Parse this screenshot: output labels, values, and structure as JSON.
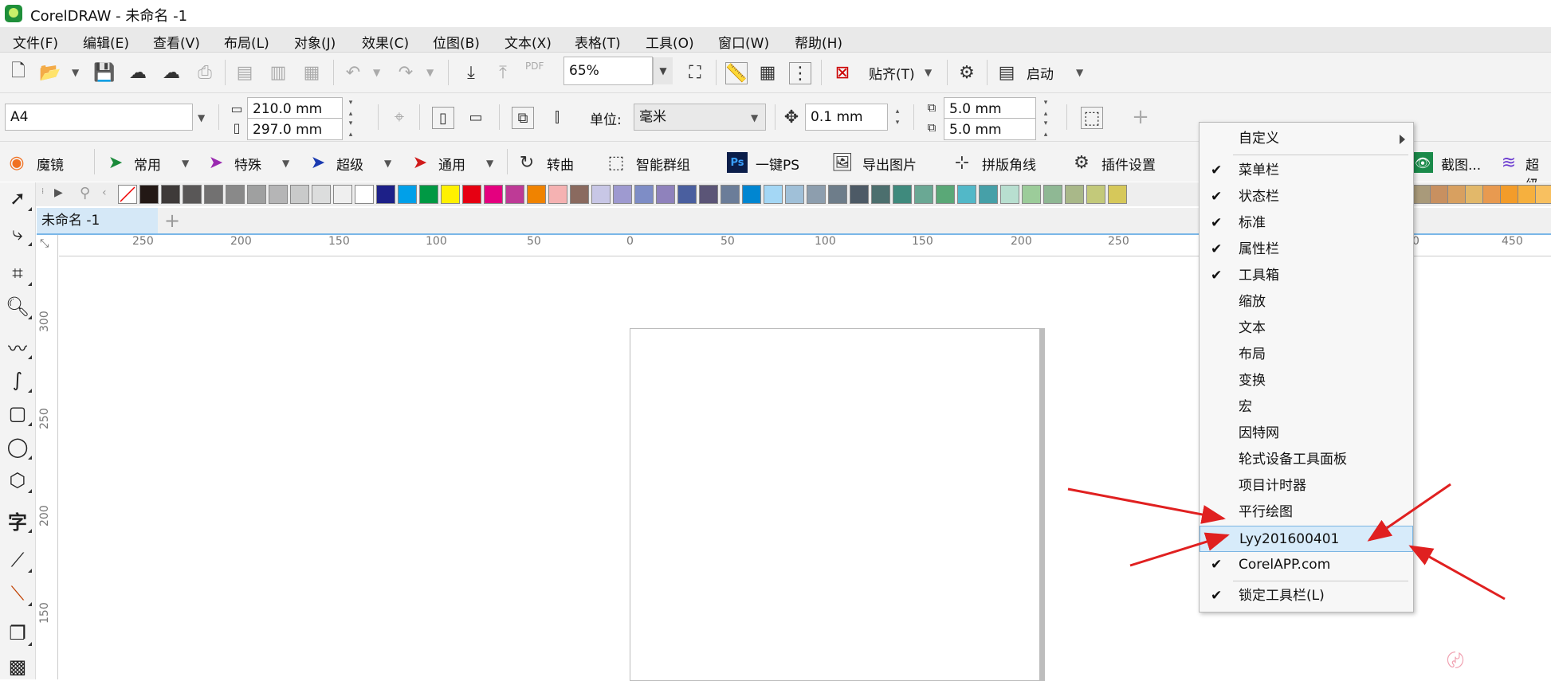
{
  "window": {
    "title": "CorelDRAW - 未命名 -1"
  },
  "menubar": {
    "items": [
      "文件(F)",
      "编辑(E)",
      "查看(V)",
      "布局(L)",
      "对象(J)",
      "效果(C)",
      "位图(B)",
      "文本(X)",
      "表格(T)",
      "工具(O)",
      "窗口(W)",
      "帮助(H)"
    ]
  },
  "toolbar1": {
    "zoom_value": "65%",
    "snap_label": "贴齐(T)",
    "launch_label": "启动",
    "pdf_label": "PDF"
  },
  "toolbar2": {
    "page_size": "A4",
    "width": "210.0 mm",
    "height": "297.0 mm",
    "units_label": "单位:",
    "units_value": "毫米",
    "nudge": "0.1 mm",
    "dup_x": "5.0 mm",
    "dup_y": "5.0 mm"
  },
  "toolbar3": {
    "items": [
      "魔镜",
      "常用",
      "特殊",
      "超级",
      "通用",
      "转曲",
      "智能群组",
      "一键PS",
      "导出图片",
      "拼版角线",
      "插件设置"
    ],
    "right_items": [
      "截图...",
      "超级"
    ],
    "ps_badge": "Ps"
  },
  "palette": {
    "colors": [
      "#231815",
      "#3e3a39",
      "#595757",
      "#727171",
      "#898989",
      "#9fa0a0",
      "#b5b5b6",
      "#c9caca",
      "#dcdddd",
      "#efefef",
      "#ffffff",
      "#1d2088",
      "#00a0e9",
      "#009944",
      "#fff100",
      "#e60012",
      "#e4007f",
      "#be3a96",
      "#f08300",
      "#f5b2b2",
      "#8a6a5f",
      "#c8c7e6",
      "#9e9ad0",
      "#7e8dc6",
      "#8f82bc",
      "#4a5f9f",
      "#5b5577",
      "#6b7d99",
      "#0086d1",
      "#a4d7f5",
      "#a0c0d8",
      "#8d9eae",
      "#6e7d8a",
      "#4d5a66",
      "#4c6f6e",
      "#3f8a7d",
      "#6aa894",
      "#5aa877",
      "#52b8c8",
      "#46a0a8",
      "#b8dfd0",
      "#9ccc9a",
      "#8fb894",
      "#a9b889",
      "#c3c97a",
      "#d6c85a"
    ],
    "right_colors": [
      "#a99a7a",
      "#c89060",
      "#d8a060",
      "#e2b86a",
      "#e89a50",
      "#f39c2a",
      "#f6b03e",
      "#f8c060"
    ]
  },
  "document": {
    "tab_name": "未命名 -1"
  },
  "ruler": {
    "h_labels": [
      "250",
      "200",
      "150",
      "100",
      "50",
      "0",
      "50",
      "100",
      "150",
      "200",
      "250",
      "0",
      "450"
    ],
    "v_labels": [
      "300",
      "250",
      "200",
      "150"
    ]
  },
  "context_menu": {
    "customize": "自定义",
    "items": [
      {
        "label": "菜单栏",
        "checked": true
      },
      {
        "label": "状态栏",
        "checked": true
      },
      {
        "label": "标准",
        "checked": true
      },
      {
        "label": "属性栏",
        "checked": true
      },
      {
        "label": "工具箱",
        "checked": true
      },
      {
        "label": "缩放",
        "checked": false
      },
      {
        "label": "文本",
        "checked": false
      },
      {
        "label": "布局",
        "checked": false
      },
      {
        "label": "变换",
        "checked": false
      },
      {
        "label": "宏",
        "checked": false
      },
      {
        "label": "因特网",
        "checked": false
      },
      {
        "label": "轮式设备工具面板",
        "checked": false
      },
      {
        "label": "项目计时器",
        "checked": false
      },
      {
        "label": "平行绘图",
        "checked": false
      },
      {
        "label": "Lyy201600401",
        "checked": false,
        "highlighted": true
      },
      {
        "label": "CorelAPP.com",
        "checked": true
      }
    ],
    "lock_label": "锁定工具栏(L)",
    "lock_checked": true,
    "check_glyph": "✔"
  },
  "colors": {
    "accent": "#7ab7e8",
    "annotation_arrow": "#e02020"
  }
}
